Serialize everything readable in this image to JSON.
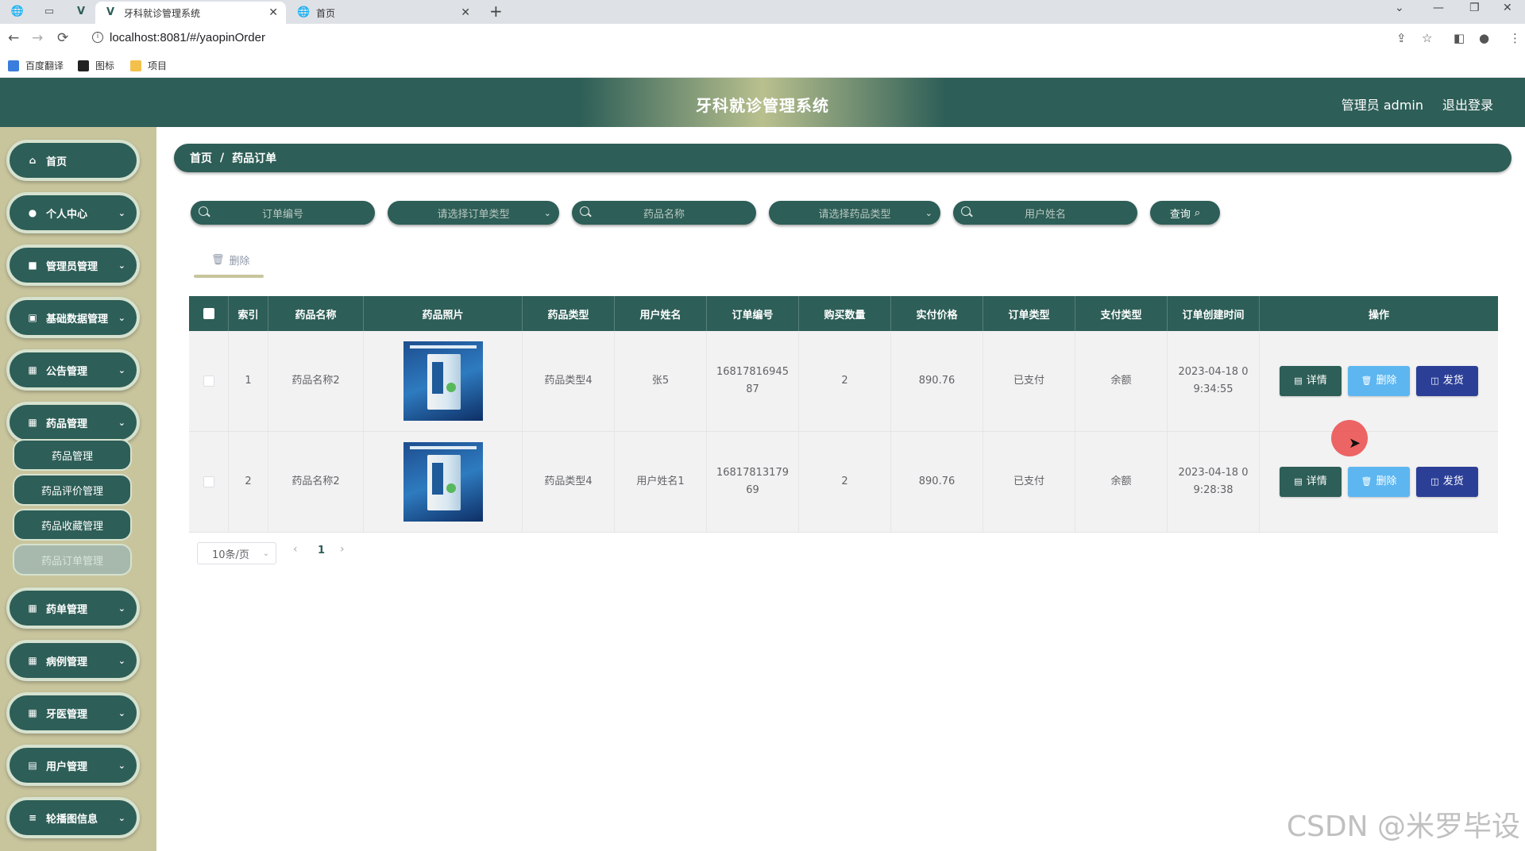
{
  "browser": {
    "tabs": [
      {
        "title": "牙科就诊管理系统",
        "active": true
      },
      {
        "title": "首页",
        "active": false
      }
    ],
    "url": "localhost:8081/#/yaopinOrder",
    "bookmarks": [
      "百度翻译",
      "图标",
      "项目"
    ]
  },
  "header": {
    "title": "牙科就诊管理系统",
    "admin": "管理员 admin",
    "logout": "退出登录"
  },
  "sidebar": {
    "items": [
      {
        "label": "首页",
        "icon": "home-icon",
        "expandable": false
      },
      {
        "label": "个人中心",
        "icon": "user-icon",
        "expandable": true
      },
      {
        "label": "管理员管理",
        "icon": "monitor-icon",
        "expandable": true
      },
      {
        "label": "基础数据管理",
        "icon": "chart-icon",
        "expandable": true
      },
      {
        "label": "公告管理",
        "icon": "grid-icon",
        "expandable": true
      },
      {
        "label": "药品管理",
        "icon": "grid-icon",
        "expandable": true
      },
      {
        "label": "药单管理",
        "icon": "grid-icon",
        "expandable": true
      },
      {
        "label": "病例管理",
        "icon": "grid-icon",
        "expandable": true
      },
      {
        "label": "牙医管理",
        "icon": "grid-icon",
        "expandable": true
      },
      {
        "label": "用户管理",
        "icon": "clipboard-icon",
        "expandable": true
      },
      {
        "label": "轮播图信息",
        "icon": "list-icon",
        "expandable": true
      }
    ],
    "submenu": [
      {
        "label": "药品管理",
        "active": false
      },
      {
        "label": "药品评价管理",
        "active": false
      },
      {
        "label": "药品收藏管理",
        "active": false
      },
      {
        "label": "药品订单管理",
        "active": true
      }
    ]
  },
  "breadcrumb": {
    "home": "首页",
    "separator": "/",
    "current": "药品订单"
  },
  "search": {
    "order_no_placeholder": "订单编号",
    "order_type_placeholder": "请选择订单类型",
    "drug_name_placeholder": "药品名称",
    "drug_type_placeholder": "请选择药品类型",
    "user_name_placeholder": "用户姓名",
    "query_label": "查询"
  },
  "actions": {
    "delete_label": "删除"
  },
  "table": {
    "columns": [
      "索引",
      "药品名称",
      "药品照片",
      "药品类型",
      "用户姓名",
      "订单编号",
      "购买数量",
      "实付价格",
      "订单类型",
      "支付类型",
      "订单创建时间",
      "操作"
    ],
    "rows": [
      {
        "index": "1",
        "drug_name": "药品名称2",
        "drug_type": "药品类型4",
        "user_name": "张5",
        "order_no": "1681781694587",
        "order_no_a": "16817816945",
        "order_no_b": "87",
        "qty": "2",
        "price": "890.76",
        "order_type": "已支付",
        "pay_type": "余额",
        "created_a": "2023-04-18 0",
        "created_b": "9:34:55"
      },
      {
        "index": "2",
        "drug_name": "药品名称2",
        "drug_type": "药品类型4",
        "user_name": "用户姓名1",
        "order_no": "1681781317969",
        "order_no_a": "16817813179",
        "order_no_b": "69",
        "qty": "2",
        "price": "890.76",
        "order_type": "已支付",
        "pay_type": "余额",
        "created_a": "2023-04-18 0",
        "created_b": "9:28:38"
      }
    ],
    "op_labels": {
      "detail": "详情",
      "delete": "删除",
      "ship": "发货"
    }
  },
  "pagination": {
    "page_size": "10条/页",
    "current_page": "1"
  },
  "watermark": "CSDN @米罗毕设",
  "colors": {
    "primary": "#2d5e57",
    "sidebar_bg": "#c8c59d",
    "delete_btn": "#5db6f0",
    "ship_btn": "#2c3f97"
  }
}
